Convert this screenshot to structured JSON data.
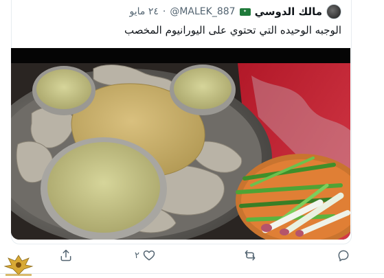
{
  "tweet": {
    "display_name": "مالك الدوسي",
    "flag_icon": "saudi-flag-icon",
    "handle": "@MALEK_887",
    "separator": "·",
    "date": "٢٤ مايو",
    "text": "الوجبه الوحيده التي تحتوي على اليورانيوم المخصب"
  },
  "actions": {
    "reply_icon": "reply-icon",
    "retweet_icon": "retweet-icon",
    "like_icon": "heart-icon",
    "like_count": "٢",
    "share_icon": "share-icon"
  },
  "colors": {
    "icon_gray": "#536471",
    "border": "#e6ecf0"
  }
}
